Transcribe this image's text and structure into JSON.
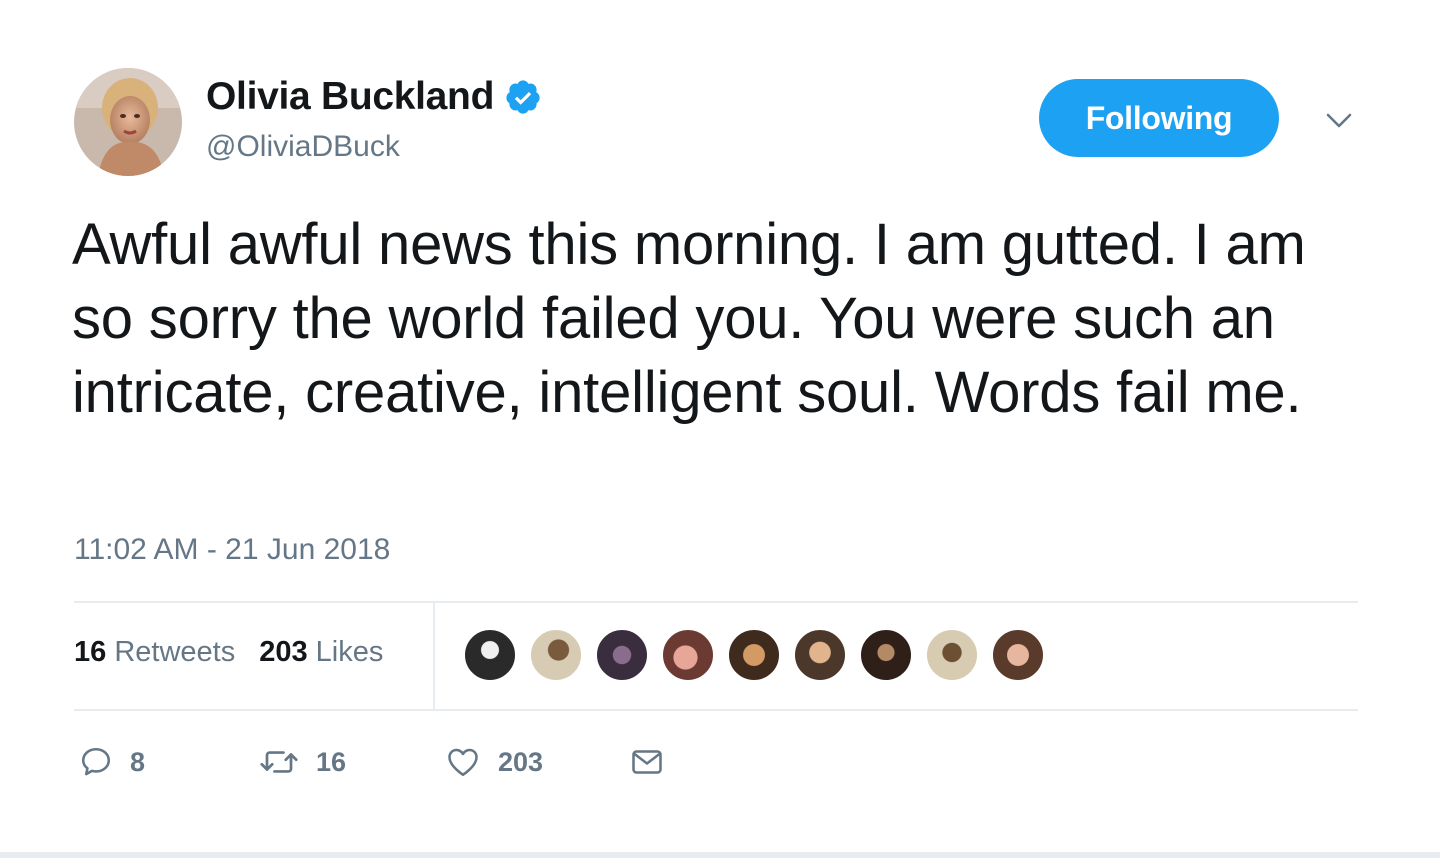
{
  "tweet": {
    "author": {
      "display_name": "Olivia Buckland",
      "handle": "@OliviaDBuck",
      "verified": true,
      "avatar_icon": "profile-photo"
    },
    "follow_button_label": "Following",
    "text": "Awful awful news this morning. I am gutted. I am so sorry the world failed you. You were such an intricate, creative, intelligent soul. Words fail me.",
    "timestamp": "11:02 AM - 21 Jun 2018",
    "stats": {
      "retweets_count": "16",
      "retweets_label": "Retweets",
      "likes_count": "203",
      "likes_label": "Likes"
    },
    "actions": {
      "reply_count": "8",
      "retweet_count": "16",
      "like_count": "203"
    }
  },
  "icons": {
    "verified": "verified-badge-icon",
    "caret": "chevron-down-icon",
    "reply": "reply-icon",
    "retweet": "retweet-icon",
    "like": "heart-icon",
    "dm": "envelope-icon"
  },
  "colors": {
    "accent": "#1da1f2",
    "text": "#14171a",
    "muted": "#657786",
    "divider": "#e6ecf0"
  }
}
